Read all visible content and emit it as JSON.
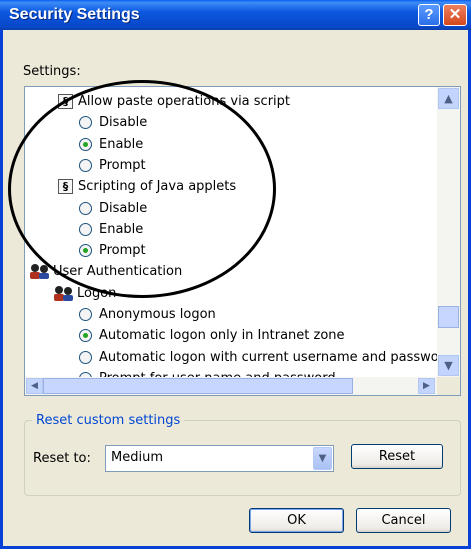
{
  "window": {
    "title": "Security Settings",
    "help_glyph": "?",
    "close_glyph": "✕"
  },
  "settings_label": "Settings:",
  "tree": {
    "rows": [
      {
        "kind": "setting",
        "label": "Allow paste operations via script"
      },
      {
        "kind": "radio",
        "label": "Disable",
        "checked": false
      },
      {
        "kind": "radio",
        "label": "Enable",
        "checked": true
      },
      {
        "kind": "radio",
        "label": "Prompt",
        "checked": false
      },
      {
        "kind": "setting",
        "label": "Scripting of Java applets"
      },
      {
        "kind": "radio",
        "label": "Disable",
        "checked": false
      },
      {
        "kind": "radio",
        "label": "Enable",
        "checked": false
      },
      {
        "kind": "radio",
        "label": "Prompt",
        "checked": true
      },
      {
        "kind": "group",
        "label": "User Authentication"
      },
      {
        "kind": "subgroup",
        "label": "Logon"
      },
      {
        "kind": "radio",
        "label": "Anonymous logon",
        "checked": false
      },
      {
        "kind": "radio",
        "label": "Automatic logon only in Intranet zone",
        "checked": true
      },
      {
        "kind": "radio",
        "label": "Automatic logon with current username and passwo",
        "checked": false
      },
      {
        "kind": "radio",
        "label": "Prompt for user name and password",
        "checked": false
      }
    ],
    "icons": {
      "setting": "script-settings-icon",
      "group": "users-icon"
    }
  },
  "scrollbar": {
    "up_glyph": "▲",
    "down_glyph": "▼",
    "left_glyph": "◀",
    "right_glyph": "▶",
    "vertical_position": 0.88,
    "horizontal_position": 0.0
  },
  "reset_group": {
    "legend": "Reset custom settings",
    "reset_to_label": "Reset to:",
    "reset_to_value": "Medium",
    "reset_button": "Reset"
  },
  "buttons": {
    "ok": "OK",
    "cancel": "Cancel"
  },
  "colors": {
    "title_bar": "#0a55dc",
    "legend_text": "#0046d5",
    "radio_checked": "#22a322"
  }
}
